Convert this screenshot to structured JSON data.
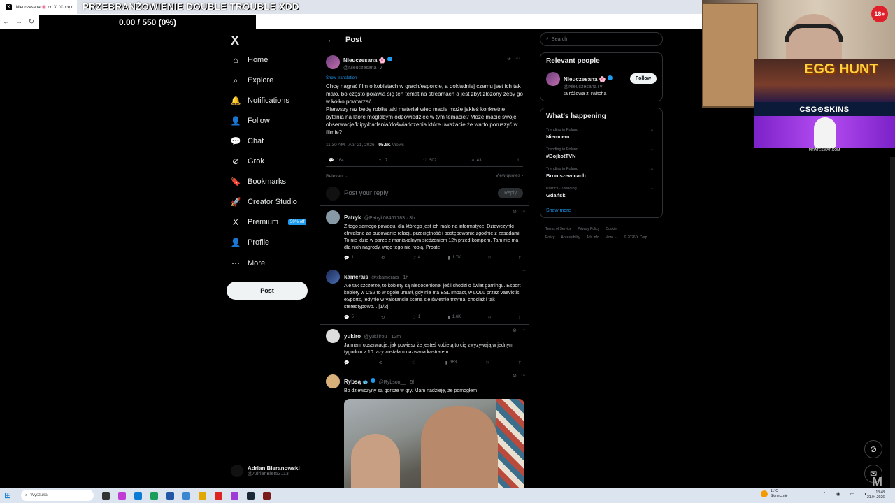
{
  "browser": {
    "tab_title": "Nieuczesana 🌸 on X: \"Chcę n",
    "overlay_title": "PRZEBRANŻOWIENIE DOUBLE TROUBLE XDD",
    "progress_text": "0.00 / 550 (0%)",
    "nav": {
      "back": "←",
      "forward": "→",
      "reload": "↻"
    }
  },
  "sidebar": {
    "logo": "X",
    "items": [
      {
        "label": "Home",
        "icon": "home-icon",
        "glyph": "⌂"
      },
      {
        "label": "Explore",
        "icon": "search-icon",
        "glyph": "⌕"
      },
      {
        "label": "Notifications",
        "icon": "bell-icon",
        "glyph": "🔔"
      },
      {
        "label": "Follow",
        "icon": "follow-icon",
        "glyph": "👤"
      },
      {
        "label": "Chat",
        "icon": "chat-icon",
        "glyph": "💬"
      },
      {
        "label": "Grok",
        "icon": "grok-icon",
        "glyph": "⊘"
      },
      {
        "label": "Bookmarks",
        "icon": "bookmark-icon",
        "glyph": "🔖"
      },
      {
        "label": "Creator Studio",
        "icon": "rocket-icon",
        "glyph": "🚀"
      },
      {
        "label": "Premium",
        "icon": "x-premium-icon",
        "glyph": "X"
      },
      {
        "label": "Profile",
        "icon": "profile-icon",
        "glyph": "👤"
      },
      {
        "label": "More",
        "icon": "more-icon",
        "glyph": "⋯"
      }
    ],
    "premium_badge": "50% off",
    "post_button": "Post",
    "account": {
      "name": "Adrian Bieranowski",
      "handle": "@AdrianBier53113",
      "more": "···"
    }
  },
  "main": {
    "header_title": "Post",
    "back_glyph": "←",
    "post": {
      "author": "Nieuczesana 🌸",
      "handle": "@NieuczesanaTv",
      "show_translation": "Show translation",
      "text": "Chcę nagrać film o kobietach w grach/esporcie, a dokładniej czemu jest ich tak mało, bo często pojawia się ten temat na streamach a jest zbyt złożony żeby go w kółko powtarzać.\nPierwszy raz będę robiła taki materiał więc macie może jakieś konkretne pytania na które mogłabym odpowiedzieć w tym temacie? Może macie swoje obserwacje/klipy/badania/doświadczenia które uważacie że warto poruszyć w filmie?",
      "time": "11:30 AM · Apr 21, 2026 · ",
      "views": "95.8K",
      "views_label": " Views",
      "replies": "164",
      "reposts": "7",
      "likes": "502",
      "bookmarks": "43",
      "sort_label": "Relevant ⌄",
      "view_quotes": "View quotes ›"
    },
    "reply_placeholder": "Post your reply",
    "reply_button": "Reply",
    "replies": [
      {
        "name": "Patryk",
        "handle": "@Patryk08467783 · 3h",
        "text": "Z tego samego powodu, dla którego jest ich mało na informatyce. Dziewczynki chwalone za budowanie relacji, przeciętność i postępowanie zgodnie z zasadami. To nie idzie w parze z maniakalnym siedzeniem 12h przed kompem. Tam nie ma dla nich nagrody, więc tego nie robią. Proste",
        "replies": "1",
        "reposts": "",
        "likes": "4",
        "views": "1.7K"
      },
      {
        "name": "kamerais",
        "handle": "@xkamerais · 1h",
        "text": "Ale tak szczerze, to kobiety są niedocenione, jeśli chodzi o świat gamingu. Esport kobiety w CS2 to w ogóle umarł, gdy nie ma ESL Impact, w LOLu przez Vaevictis eSports, jedynie w Valorancie scena się świetnie trzyma, chociaż i tak stereotypowo... [1/2]",
        "replies": "5",
        "reposts": "",
        "likes": "1",
        "views": "1.6K"
      },
      {
        "name": "yukiro",
        "handle": "@yukiiirou · 12m",
        "text": "Ja mam obserwacje: jak powiesz że jesteś kobietą to cię zwyzywają w jednym tygodniu z 10 razy zostałam nazwana kastratem.",
        "replies": "",
        "reposts": "",
        "likes": "",
        "views": "363"
      },
      {
        "name": "Rybsą 🐟",
        "handle": "@Rybson__ · 5h",
        "text": "Bo dziewczyny są gorsze w gry. Mam nadzieję, że pomogłem"
      }
    ]
  },
  "right": {
    "search_placeholder": "Search",
    "relevant_title": "Relevant people",
    "person": {
      "name": "Nieuczesana 🌸",
      "handle": "@NieuczesanaTv",
      "bio": "ta różowa z Twitcha",
      "follow": "Follow"
    },
    "happening_title": "What's happening",
    "trends": [
      {
        "context": "Trending in Poland",
        "name": "Niemcem"
      },
      {
        "context": "Trending in Poland",
        "name": "#BojkotTVN"
      },
      {
        "context": "Trending in Poland",
        "name": "Broniszewicach"
      },
      {
        "context": "Politics · Trending",
        "name": "Gdańsk"
      }
    ],
    "show_more": "Show more",
    "footer": [
      "Terms of Service",
      "Privacy Policy",
      "Cookie Policy",
      "Accessibility",
      "Ads info",
      "More ···",
      "© 2026 X Corp."
    ]
  },
  "stream_overlay": {
    "age_badge": "18+",
    "ad_headline": "EGG HUNT",
    "ad_brand": "CSG⊙SKINS",
    "ad_footer": "PIRATESWAP.COM"
  },
  "taskbar": {
    "search_placeholder": "Wyszukaj",
    "weather_temp": "11°C",
    "weather_desc": "Słonecznie",
    "time": "13:48",
    "date": "21.04.2026"
  },
  "colors": {
    "accent": "#1d9bf0",
    "background": "#000000",
    "border": "#2f3336"
  }
}
